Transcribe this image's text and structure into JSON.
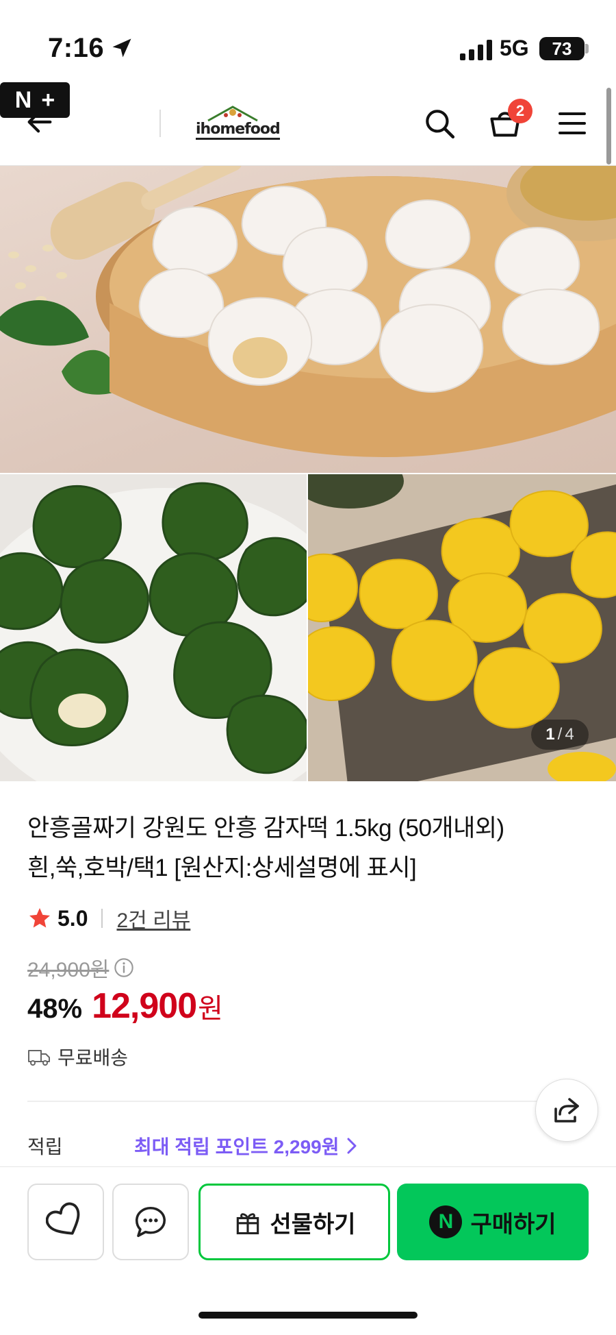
{
  "status_bar": {
    "time": "7:16",
    "network": "5G",
    "battery": "73",
    "icons": [
      "location-arrow-icon",
      "signal-bars-icon"
    ]
  },
  "header": {
    "back_icon": "arrow-left-icon",
    "nplus_badge": [
      "N",
      "+"
    ],
    "store_logo_text": "ihomefood",
    "search_icon": "search-icon",
    "cart_icon": "cart-icon",
    "cart_count": "2",
    "menu_icon": "hamburger-menu-icon"
  },
  "gallery": {
    "current_page": "1",
    "total_pages": "4",
    "page_separator": "/",
    "images": [
      "white-potato-rice-cakes-on-bamboo-steamer",
      "green-mugwort-rice-cakes",
      "yellow-pumpkin-rice-cakes"
    ]
  },
  "product": {
    "title_line1": "안흥골짜기 강원도 안흥 감자떡 1.5kg (50개내외)",
    "title_line2": "흰,쑥,호박/택1 [원산지:상세설명에 표시]",
    "rating": "5.0",
    "review_link": "2건 리뷰",
    "original_price": "24,900원",
    "discount": "48%",
    "sale_price": "12,900",
    "price_unit": "원",
    "delivery": "무료배송",
    "points_label": "적립",
    "points_value": "최대 적립 포인트 2,299원"
  },
  "bottom_bar": {
    "wish_icon": "heart-icon",
    "talk_icon": "chat-bubble-icon",
    "gift_label": "선물하기",
    "buy_label": "구매하기",
    "npay_letter": "N"
  },
  "colors": {
    "sale_red": "#d0021b",
    "naver_green": "#03c75a",
    "points_purple": "#7c5cf5",
    "badge_red": "#f04438"
  }
}
